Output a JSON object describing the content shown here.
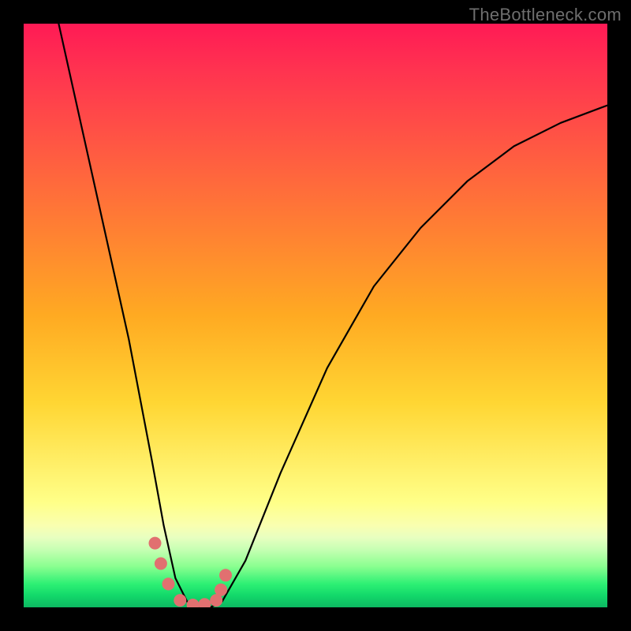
{
  "watermark": "TheBottleneck.com",
  "chart_data": {
    "type": "line",
    "title": "",
    "xlabel": "",
    "ylabel": "",
    "xlim": [
      0,
      100
    ],
    "ylim": [
      0,
      100
    ],
    "series": [
      {
        "name": "bottleneck-curve",
        "x": [
          6,
          10,
          14,
          18,
          22,
          24,
          26,
          28,
          30,
          32,
          34,
          38,
          44,
          52,
          60,
          68,
          76,
          84,
          92,
          100
        ],
        "values": [
          100,
          82,
          64,
          46,
          25,
          14,
          5,
          1,
          0,
          0,
          1,
          8,
          23,
          41,
          55,
          65,
          73,
          79,
          83,
          86
        ]
      }
    ],
    "markers": {
      "name": "highlight-dots",
      "x": [
        22.5,
        23.5,
        24.8,
        26.8,
        29.0,
        31.0,
        33.0,
        33.8,
        34.6
      ],
      "values": [
        11.0,
        7.5,
        4.0,
        1.2,
        0.4,
        0.5,
        1.2,
        3.0,
        5.5
      ],
      "color": "#e17070",
      "radius": 8
    },
    "background_gradient": {
      "stops": [
        {
          "pos": 0.0,
          "color": "#ff1a55"
        },
        {
          "pos": 0.35,
          "color": "#ff7f33"
        },
        {
          "pos": 0.65,
          "color": "#ffd633"
        },
        {
          "pos": 0.86,
          "color": "#f9ffb0"
        },
        {
          "pos": 1.0,
          "color": "#0db862"
        }
      ]
    }
  }
}
